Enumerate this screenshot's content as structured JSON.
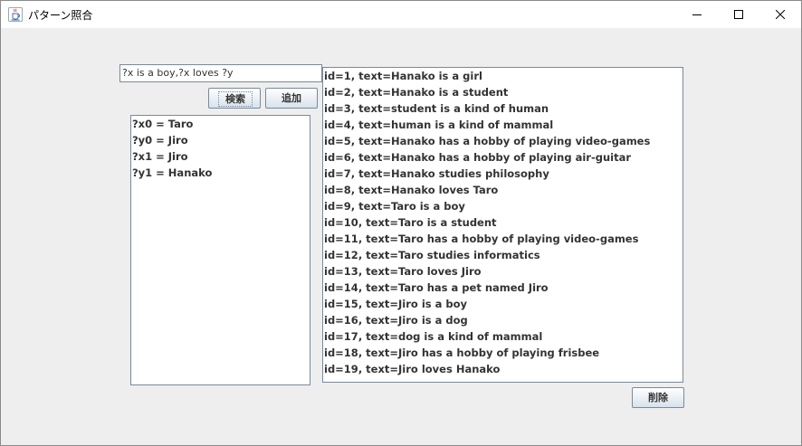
{
  "window": {
    "title": "パターン照合",
    "app_icon": "java-cup-icon"
  },
  "search": {
    "query_value": "?x is a boy,?x loves ?y",
    "search_label": "検索",
    "add_label": "追加"
  },
  "bindings": [
    "?x0 = Taro",
    "?y0 = Jiro",
    "?x1 = Jiro",
    "?y1 = Hanako"
  ],
  "facts": [
    "id=1, text=Hanako is a girl",
    "id=2, text=Hanako is a student",
    "id=3, text=student is a kind of human",
    "id=4, text=human is a kind of mammal",
    "id=5, text=Hanako has a hobby of playing video-games",
    "id=6, text=Hanako has a hobby of playing air-guitar",
    "id=7, text=Hanako studies philosophy",
    "id=8, text=Hanako loves Taro",
    "id=9, text=Taro is a boy",
    "id=10, text=Taro is a student",
    "id=11, text=Taro has a hobby of playing video-games",
    "id=12, text=Taro studies informatics",
    "id=13, text=Taro loves Jiro",
    "id=14, text=Taro has a pet named Jiro",
    "id=15, text=Jiro is a boy",
    "id=16, text=Jiro is a dog",
    "id=17, text=dog is a kind of mammal",
    "id=18, text=Jiro has a hobby of playing frisbee",
    "id=19, text=Jiro loves Hanako"
  ],
  "actions": {
    "delete_label": "削除"
  },
  "colors": {
    "window_bg": "#eeeeee",
    "text": "#333333",
    "border": "#7a8a99"
  }
}
